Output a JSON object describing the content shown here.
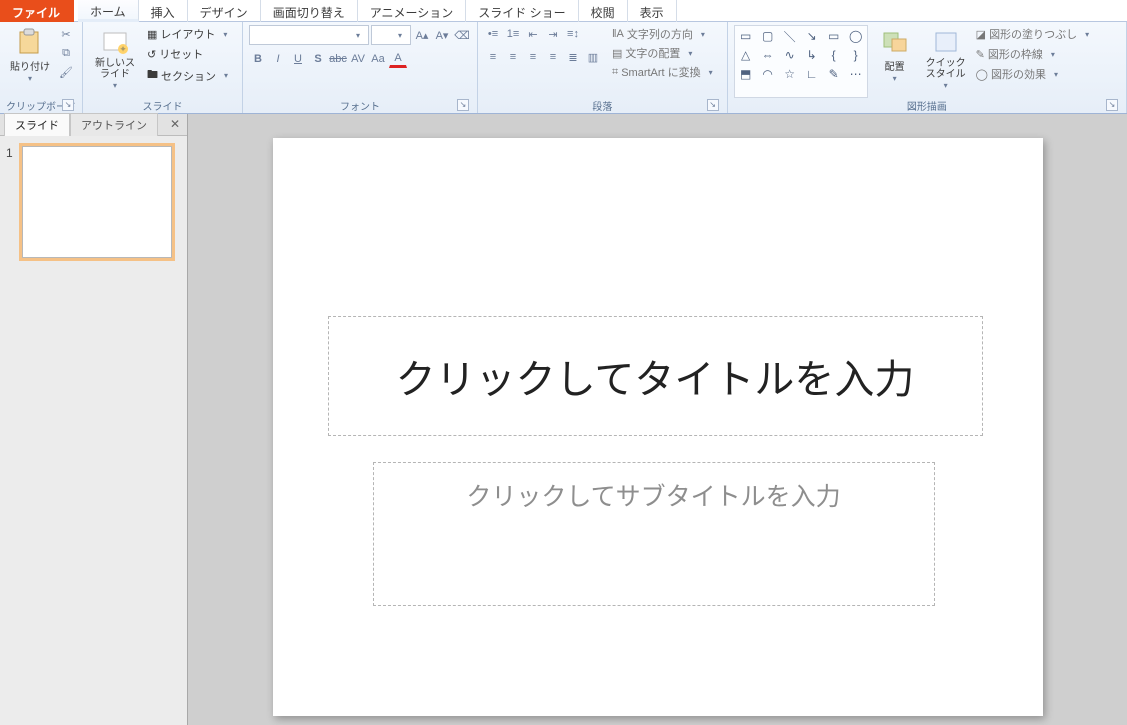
{
  "tabs": {
    "file": "ファイル",
    "items": [
      "ホーム",
      "挿入",
      "デザイン",
      "画面切り替え",
      "アニメーション",
      "スライド ショー",
      "校閲",
      "表示"
    ],
    "selected_index": 0
  },
  "ribbon": {
    "clipboard": {
      "title": "クリップボード",
      "paste": "貼り付け"
    },
    "slides": {
      "title": "スライド",
      "new_slide": "新しいスライド",
      "layout": "レイアウト",
      "reset": "リセット",
      "section": "セクション"
    },
    "font": {
      "title": "フォント",
      "font_name": "",
      "font_size": ""
    },
    "paragraph": {
      "title": "段落",
      "text_direction": "文字列の方向",
      "text_align": "文字の配置",
      "smartart": "SmartArt に変換"
    },
    "drawing": {
      "title": "図形描画",
      "arrange": "配置",
      "quick_style": "クイックスタイル",
      "shape_fill": "図形の塗りつぶし",
      "shape_outline": "図形の枠線",
      "shape_effects": "図形の効果"
    }
  },
  "side_panel": {
    "tab_slides": "スライド",
    "tab_outline": "アウトライン",
    "slide_number": "1"
  },
  "slide": {
    "title_placeholder": "クリックしてタイトルを入力",
    "subtitle_placeholder": "クリックしてサブタイトルを入力"
  }
}
